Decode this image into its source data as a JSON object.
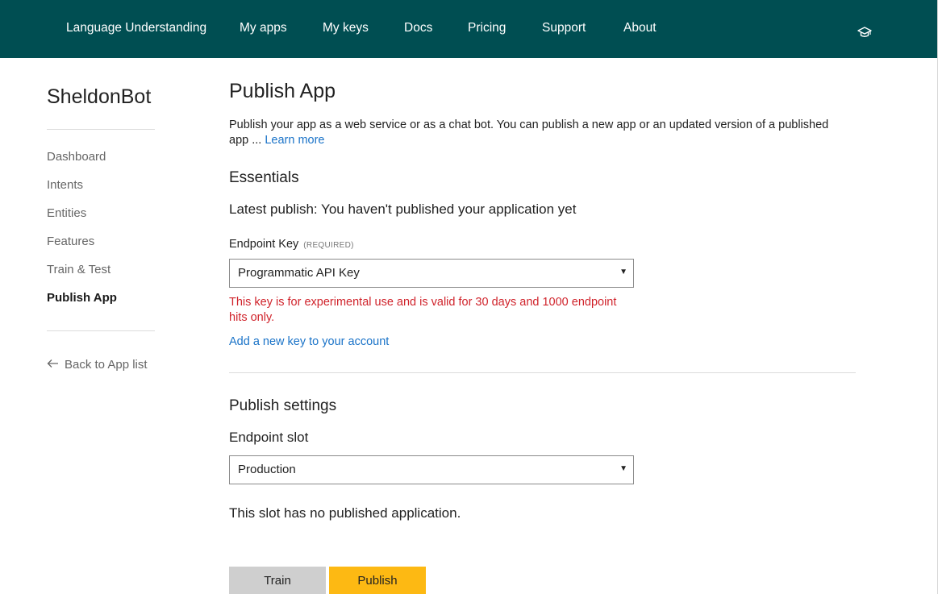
{
  "topnav": {
    "items": [
      {
        "label": "Language Understanding"
      },
      {
        "label": "My apps"
      },
      {
        "label": "My keys"
      },
      {
        "label": "Docs"
      },
      {
        "label": "Pricing"
      },
      {
        "label": "Support"
      },
      {
        "label": "About"
      }
    ],
    "user_icon": "graduation-cap-icon"
  },
  "sidebar": {
    "app_name": "SheldonBot",
    "items": [
      {
        "label": "Dashboard"
      },
      {
        "label": "Intents"
      },
      {
        "label": "Entities"
      },
      {
        "label": "Features"
      },
      {
        "label": "Train & Test"
      },
      {
        "label": "Publish App",
        "active": true
      }
    ],
    "back_label": "Back to App list",
    "back_icon": "arrow-left-icon"
  },
  "main": {
    "title": "Publish App",
    "intro_text": "Publish your app as a web service or as a chat bot. You can publish a new app or an updated version of a published app ... ",
    "learn_more": "Learn more",
    "essentials_heading": "Essentials",
    "latest_publish": "Latest publish: You haven't published your application yet",
    "endpoint_key_label": "Endpoint Key",
    "required_tag": "(REQUIRED)",
    "endpoint_key_value": "Programmatic API Key",
    "key_warning": "This key is for experimental use and is valid for 30 days and 1000 endpoint hits only.",
    "add_key_link": "Add a new key to your account",
    "publish_settings_heading": "Publish settings",
    "endpoint_slot_label": "Endpoint slot",
    "endpoint_slot_value": "Production",
    "slot_status": "This slot has no published application.",
    "train_button": "Train",
    "publish_button": "Publish",
    "caret": "▼"
  },
  "colors": {
    "header_bg": "#004e52",
    "link": "#1a73c8",
    "warning": "#d0232b",
    "publish_button": "#fdb913",
    "train_button": "#cfcfcf"
  }
}
